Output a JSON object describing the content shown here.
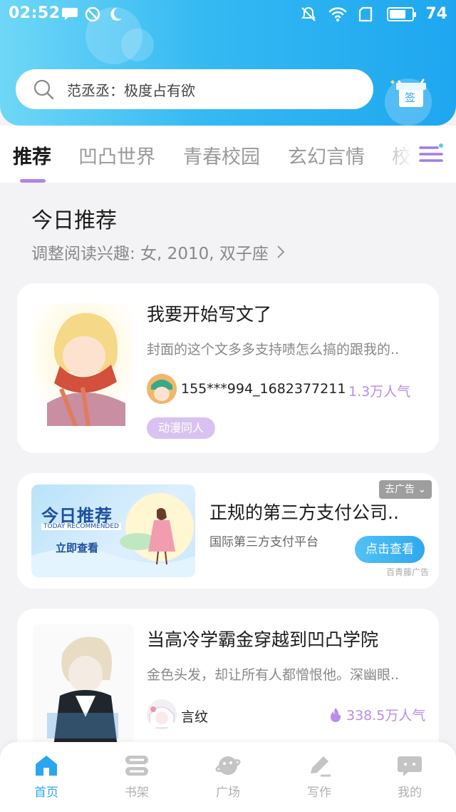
{
  "status_bar": {
    "time": "02:52",
    "battery_level": "74",
    "battery_fraction": 0.74
  },
  "search": {
    "placeholder": "范丞丞：极度占有欲"
  },
  "sign_in": {
    "label": "签"
  },
  "tabs": [
    {
      "label": "推荐",
      "active": true
    },
    {
      "label": "凹凸世界",
      "active": false
    },
    {
      "label": "青春校园",
      "active": false
    },
    {
      "label": "玄幻言情",
      "active": false
    },
    {
      "label": "校园",
      "active": false
    }
  ],
  "today": {
    "title": "今日推荐",
    "interest": "调整阅读兴趣: 女, 2010, 双子座"
  },
  "books": [
    {
      "title": "我要开始写文了",
      "desc": "封面的这个文多多支持啧怎么搞的跟我的..",
      "author": "155***994_1682377211",
      "popularity": "1.3万人气",
      "tag": "动漫同人"
    },
    {
      "title": "当高冷学霸金穿越到凹凸学院",
      "desc": "金色头发，却让所有人都憎恨他。深幽眼..",
      "author": "言纹",
      "popularity": "338.5万人气"
    }
  ],
  "ad": {
    "image_title": "今日推荐",
    "image_subtitle": "TODAY RECOMMENDED",
    "image_button": "立即查看",
    "title": "正规的第三方支付公司..",
    "desc": "国际第三方支付平台",
    "cta": "点击查看",
    "close": "去广告",
    "source": "百青藤广告"
  },
  "bottom_nav": [
    {
      "label": "首页",
      "icon": "home-icon",
      "active": true
    },
    {
      "label": "书架",
      "icon": "bookshelf-icon",
      "active": false
    },
    {
      "label": "广场",
      "icon": "planet-icon",
      "active": false
    },
    {
      "label": "写作",
      "icon": "pen-icon",
      "active": false
    },
    {
      "label": "我的",
      "icon": "chat-bubble-icon",
      "active": false
    }
  ],
  "colors": {
    "header_start": "#6fd7f7",
    "header_end": "#1ea7f0",
    "accent_purple": "#b283ea",
    "nav_active": "#2aa6ef"
  }
}
